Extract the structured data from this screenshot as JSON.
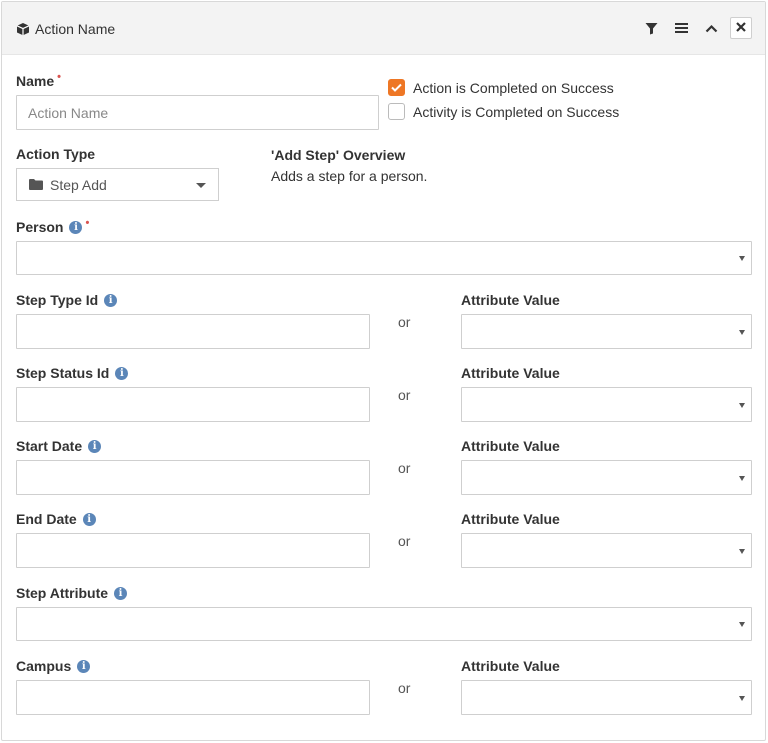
{
  "header": {
    "title": "Action Name",
    "icons": [
      "cube-icon",
      "filter-icon",
      "menu-icon",
      "chevron-up-icon",
      "close-icon"
    ]
  },
  "name": {
    "label": "Name",
    "required_marker": "•",
    "placeholder": "Action Name",
    "value": ""
  },
  "checkboxes": {
    "action_completed": {
      "label": "Action is Completed on Success",
      "checked": true
    },
    "activity_completed": {
      "label": "Activity is Completed on Success",
      "checked": false
    }
  },
  "action_type": {
    "label": "Action Type",
    "value": "Step Add",
    "icon": "folder-icon"
  },
  "overview": {
    "title": "'Add Step' Overview",
    "text": "Adds a step for a person."
  },
  "person": {
    "label": "Person",
    "required_marker": "•"
  },
  "or_label": "or",
  "attribute_value_label": "Attribute Value",
  "fields": {
    "step_type_id": {
      "label": "Step Type Id"
    },
    "step_status_id": {
      "label": "Step Status Id"
    },
    "start_date": {
      "label": "Start Date"
    },
    "end_date": {
      "label": "End Date"
    }
  },
  "step_attribute": {
    "label": "Step Attribute"
  },
  "campus": {
    "label": "Campus"
  },
  "colors": {
    "accent": "#ee7725",
    "required": "#d9534f",
    "info": "#5b86b8",
    "header_bg": "#f3f3f3",
    "border": "#cfcfcf"
  }
}
